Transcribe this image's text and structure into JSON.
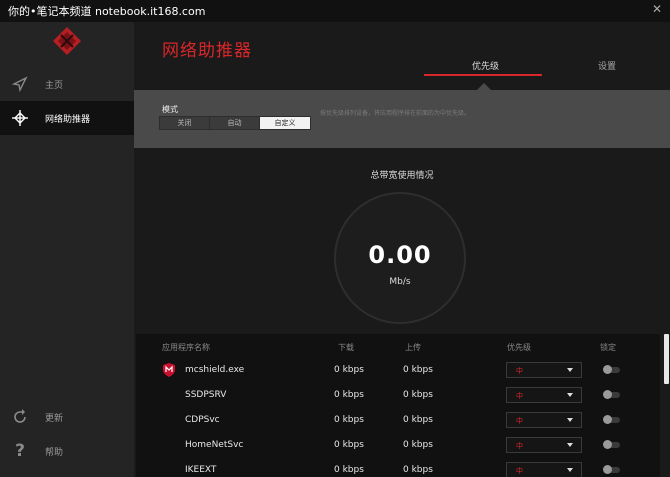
{
  "watermark": "你的•笔记本频道 notebook.it168.com",
  "sidebar": {
    "items": [
      {
        "label": "主页",
        "icon": "compass-icon"
      },
      {
        "label": "网络助推器",
        "icon": "network-crosshair-icon"
      },
      {
        "label": "更新",
        "icon": "refresh-icon"
      },
      {
        "label": "帮助",
        "icon": "help-icon"
      }
    ]
  },
  "main": {
    "title": "网络助推器",
    "tabs": [
      {
        "label": "优先级",
        "active": true
      },
      {
        "label": "设置",
        "active": false
      }
    ],
    "mode": {
      "label": "模式",
      "options": [
        "关闭",
        "自动",
        "自定义"
      ],
      "selected": "自定义",
      "description": "按优先级排列设备，将应用程序排在前面的为中优先级。"
    },
    "bandwidth": {
      "title": "总带宽使用情况",
      "value": "0.00",
      "unit": "Mb/s"
    },
    "table": {
      "columns": [
        "应用程序名称",
        "下载",
        "上传",
        "优先级",
        "锁定"
      ],
      "rows": [
        {
          "app": "mcshield.exe",
          "download": "0 kbps",
          "upload": "0 kbps",
          "priority": "中",
          "has_icon": true
        },
        {
          "app": "SSDPSRV",
          "download": "0 kbps",
          "upload": "0 kbps",
          "priority": "中",
          "has_icon": false
        },
        {
          "app": "CDPSvc",
          "download": "0 kbps",
          "upload": "0 kbps",
          "priority": "中",
          "has_icon": false
        },
        {
          "app": "HomeNetSvc",
          "download": "0 kbps",
          "upload": "0 kbps",
          "priority": "中",
          "has_icon": false
        },
        {
          "app": "IKEEXT",
          "download": "0 kbps",
          "upload": "0 kbps",
          "priority": "中",
          "has_icon": false
        }
      ]
    }
  },
  "colors": {
    "accent": "#d9262b",
    "panel": "#4a4a4a",
    "sidebar": "#242424",
    "background": "#1a1a1a"
  }
}
